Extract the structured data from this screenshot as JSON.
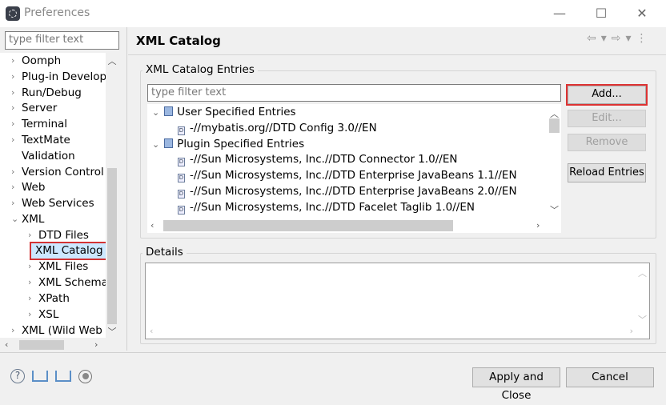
{
  "window": {
    "title": "Preferences",
    "minimize": "—",
    "maximize": "☐",
    "close": "✕"
  },
  "sidebar": {
    "filter_placeholder": "type filter text",
    "items": [
      {
        "label": "Oomph",
        "level": 0,
        "expander": "›"
      },
      {
        "label": "Plug-in Developr",
        "level": 0,
        "expander": "›"
      },
      {
        "label": "Run/Debug",
        "level": 0,
        "expander": "›"
      },
      {
        "label": "Server",
        "level": 0,
        "expander": "›"
      },
      {
        "label": "Terminal",
        "level": 0,
        "expander": "›"
      },
      {
        "label": "TextMate",
        "level": 0,
        "expander": "›"
      },
      {
        "label": "Validation",
        "level": 0,
        "expander": ""
      },
      {
        "label": "Version Control (",
        "level": 0,
        "expander": "›"
      },
      {
        "label": "Web",
        "level": 0,
        "expander": "›"
      },
      {
        "label": "Web Services",
        "level": 0,
        "expander": "›"
      },
      {
        "label": "XML",
        "level": 0,
        "expander": "⌄"
      },
      {
        "label": "DTD Files",
        "level": 1,
        "expander": "›"
      },
      {
        "label": "XML Catalog",
        "level": 1,
        "expander": "",
        "selected": true
      },
      {
        "label": "XML Files",
        "level": 1,
        "expander": "›"
      },
      {
        "label": "XML Schema I",
        "level": 1,
        "expander": "›"
      },
      {
        "label": "XPath",
        "level": 1,
        "expander": "›"
      },
      {
        "label": "XSL",
        "level": 1,
        "expander": "›"
      },
      {
        "label": "XML (Wild Web I",
        "level": 0,
        "expander": "›"
      }
    ]
  },
  "page": {
    "title": "XML Catalog",
    "nav": {
      "back": "⇦",
      "back_menu": "▾",
      "forward": "⇨",
      "forward_menu": "▾",
      "more": "⋮"
    }
  },
  "entries": {
    "group_label": "XML Catalog Entries",
    "filter_placeholder": "type filter text",
    "tree": [
      {
        "label": "User Specified Entries",
        "level": 0,
        "expander": "⌄",
        "icon": "catalog-icon"
      },
      {
        "label": "-//mybatis.org//DTD Config 3.0//EN",
        "level": 1,
        "icon": "dtd-file-icon"
      },
      {
        "label": "Plugin Specified Entries",
        "level": 0,
        "expander": "⌄",
        "icon": "catalog-icon"
      },
      {
        "label": "-//Sun Microsystems, Inc.//DTD Connector 1.0//EN",
        "level": 1,
        "icon": "dtd-file-icon"
      },
      {
        "label": "-//Sun Microsystems, Inc.//DTD Enterprise JavaBeans 1.1//EN",
        "level": 1,
        "icon": "dtd-file-icon"
      },
      {
        "label": "-//Sun Microsystems, Inc.//DTD Enterprise JavaBeans 2.0//EN",
        "level": 1,
        "icon": "dtd-file-icon"
      },
      {
        "label": "-//Sun Microsystems, Inc.//DTD Facelet Taglib 1.0//EN",
        "level": 1,
        "icon": "dtd-file-icon"
      }
    ],
    "buttons": {
      "add": "Add...",
      "edit": "Edit...",
      "remove": "Remove",
      "reload": "Reload Entries"
    }
  },
  "details": {
    "group_label": "Details"
  },
  "footer": {
    "apply_close": "Apply and Close",
    "cancel": "Cancel",
    "icons": [
      "help-icon",
      "import-icon",
      "export-icon",
      "record-icon"
    ]
  },
  "colors": {
    "highlight": "#d33333",
    "selection": "#cce8ff"
  }
}
